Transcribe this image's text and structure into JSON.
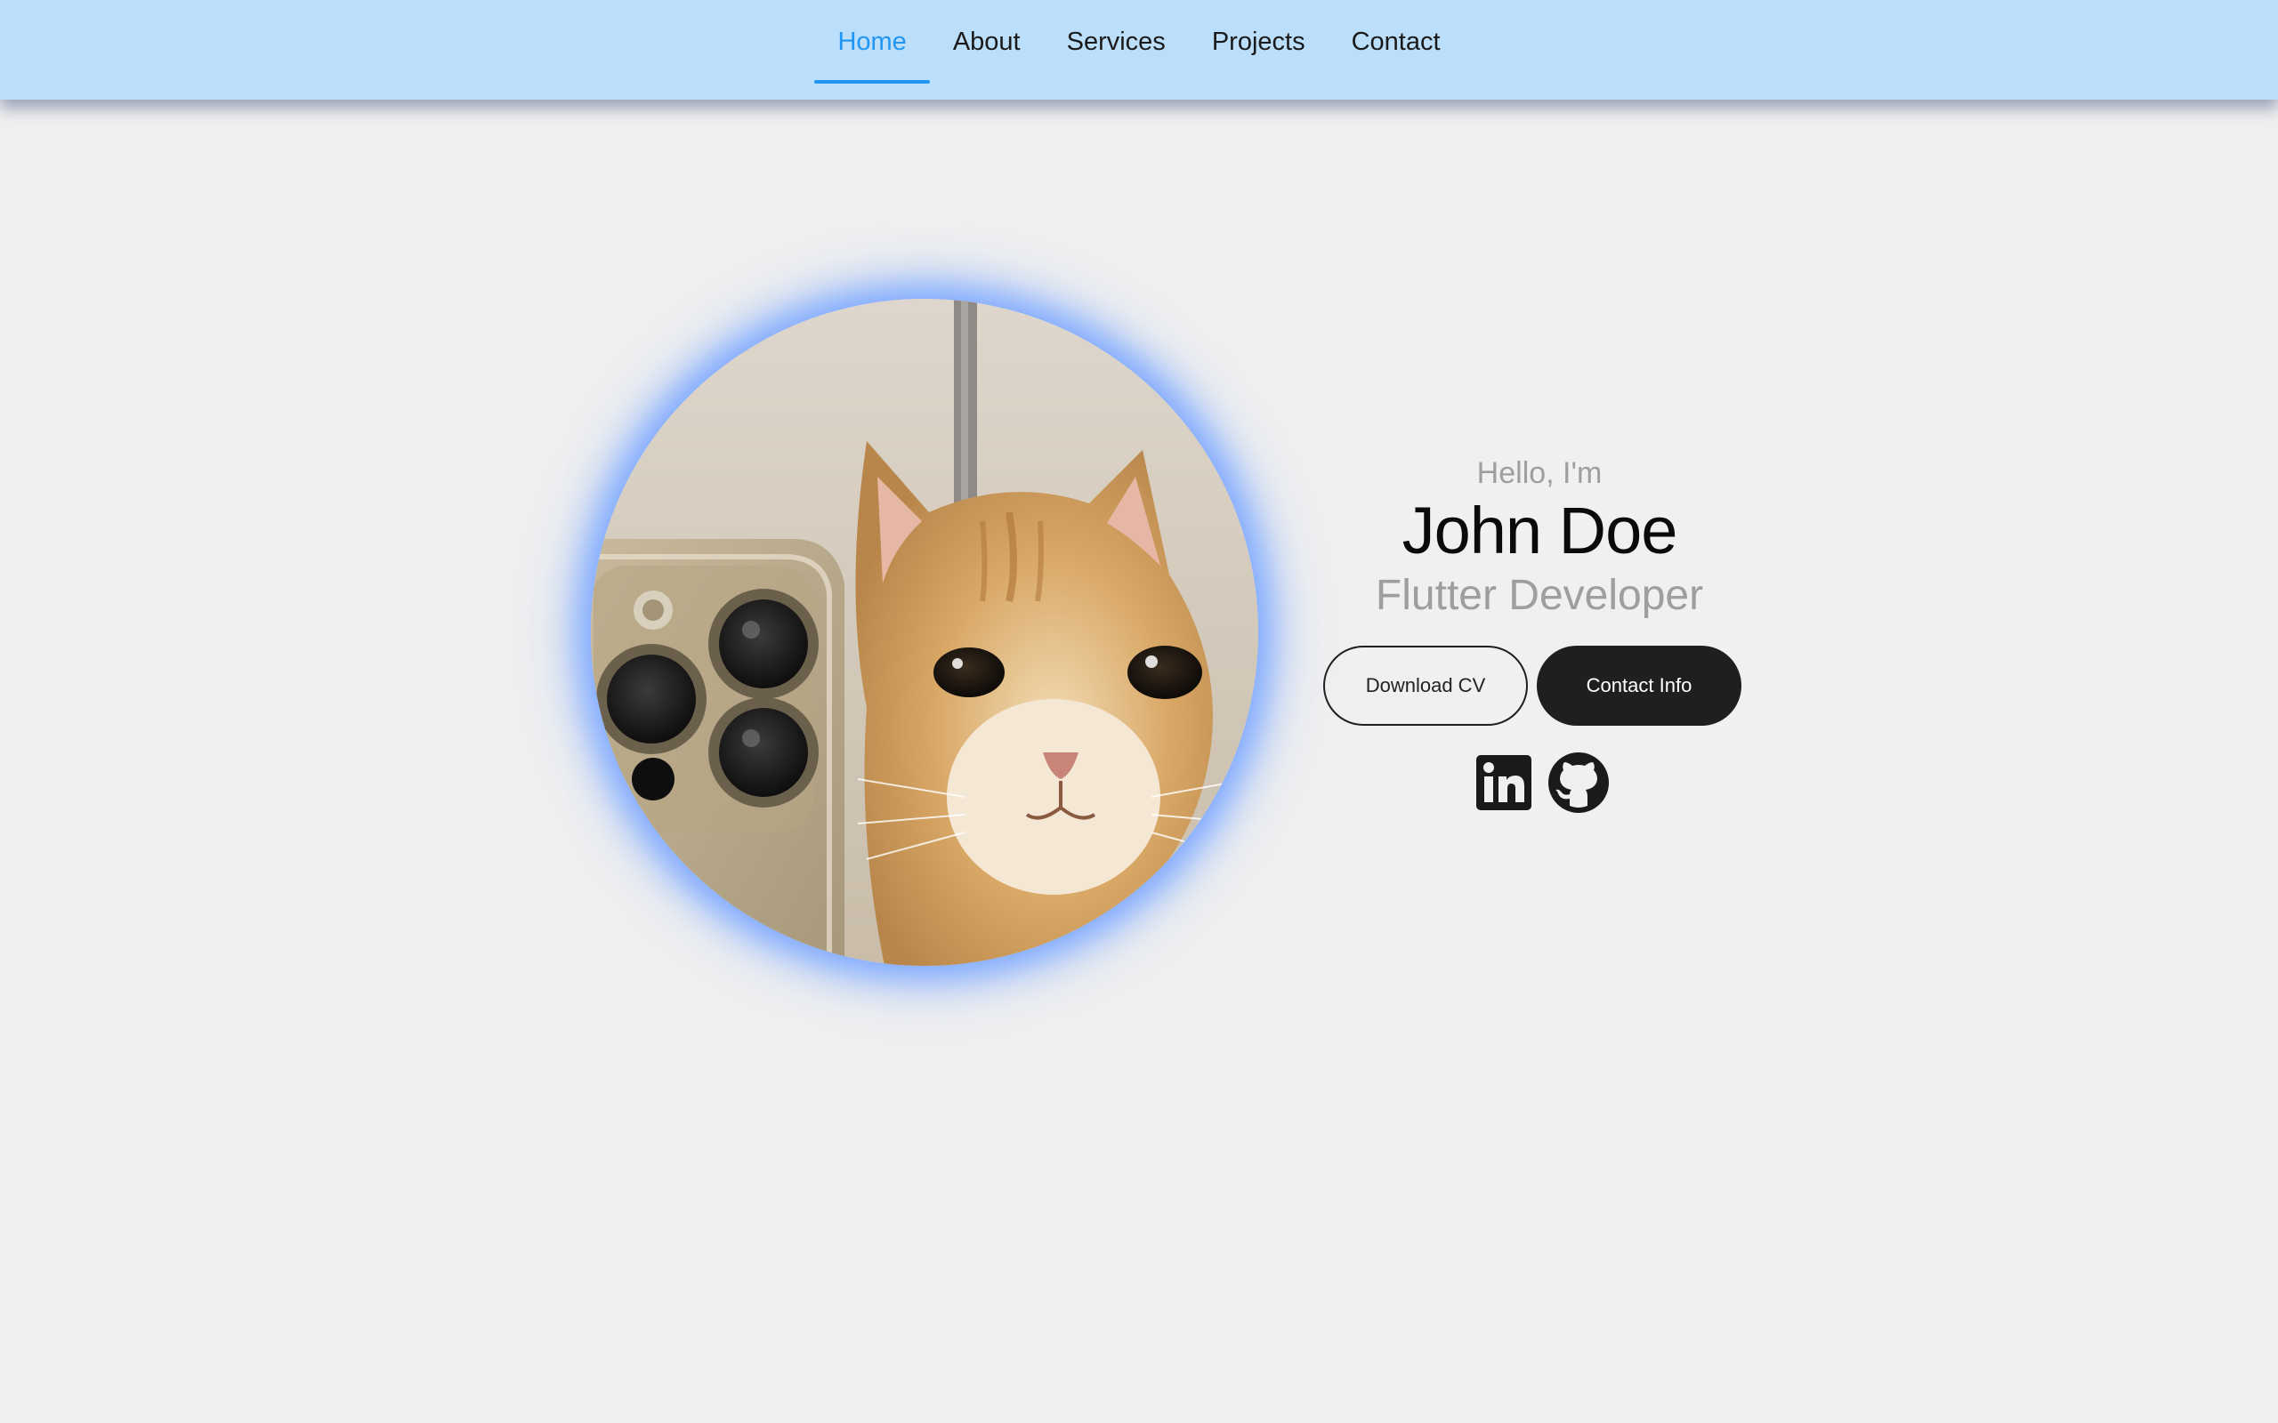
{
  "nav": {
    "items": [
      {
        "label": "Home",
        "active": true
      },
      {
        "label": "About",
        "active": false
      },
      {
        "label": "Services",
        "active": false
      },
      {
        "label": "Projects",
        "active": false
      },
      {
        "label": "Contact",
        "active": false
      }
    ]
  },
  "hero": {
    "greeting": "Hello, I'm",
    "name": "John Doe",
    "role": "Flutter Developer",
    "photo_subject": "kitten-selfie-photo",
    "download_cv_label": "Download CV",
    "contact_info_label": "Contact Info",
    "socials": [
      {
        "name": "linkedin-icon"
      },
      {
        "name": "github-icon"
      }
    ]
  },
  "colors": {
    "navbar_bg": "#bbdefb",
    "accent": "#2196f3",
    "page_bg": "#f0f0f0",
    "button_dark": "#1f1f1f",
    "muted_text": "#9e9e9e"
  }
}
